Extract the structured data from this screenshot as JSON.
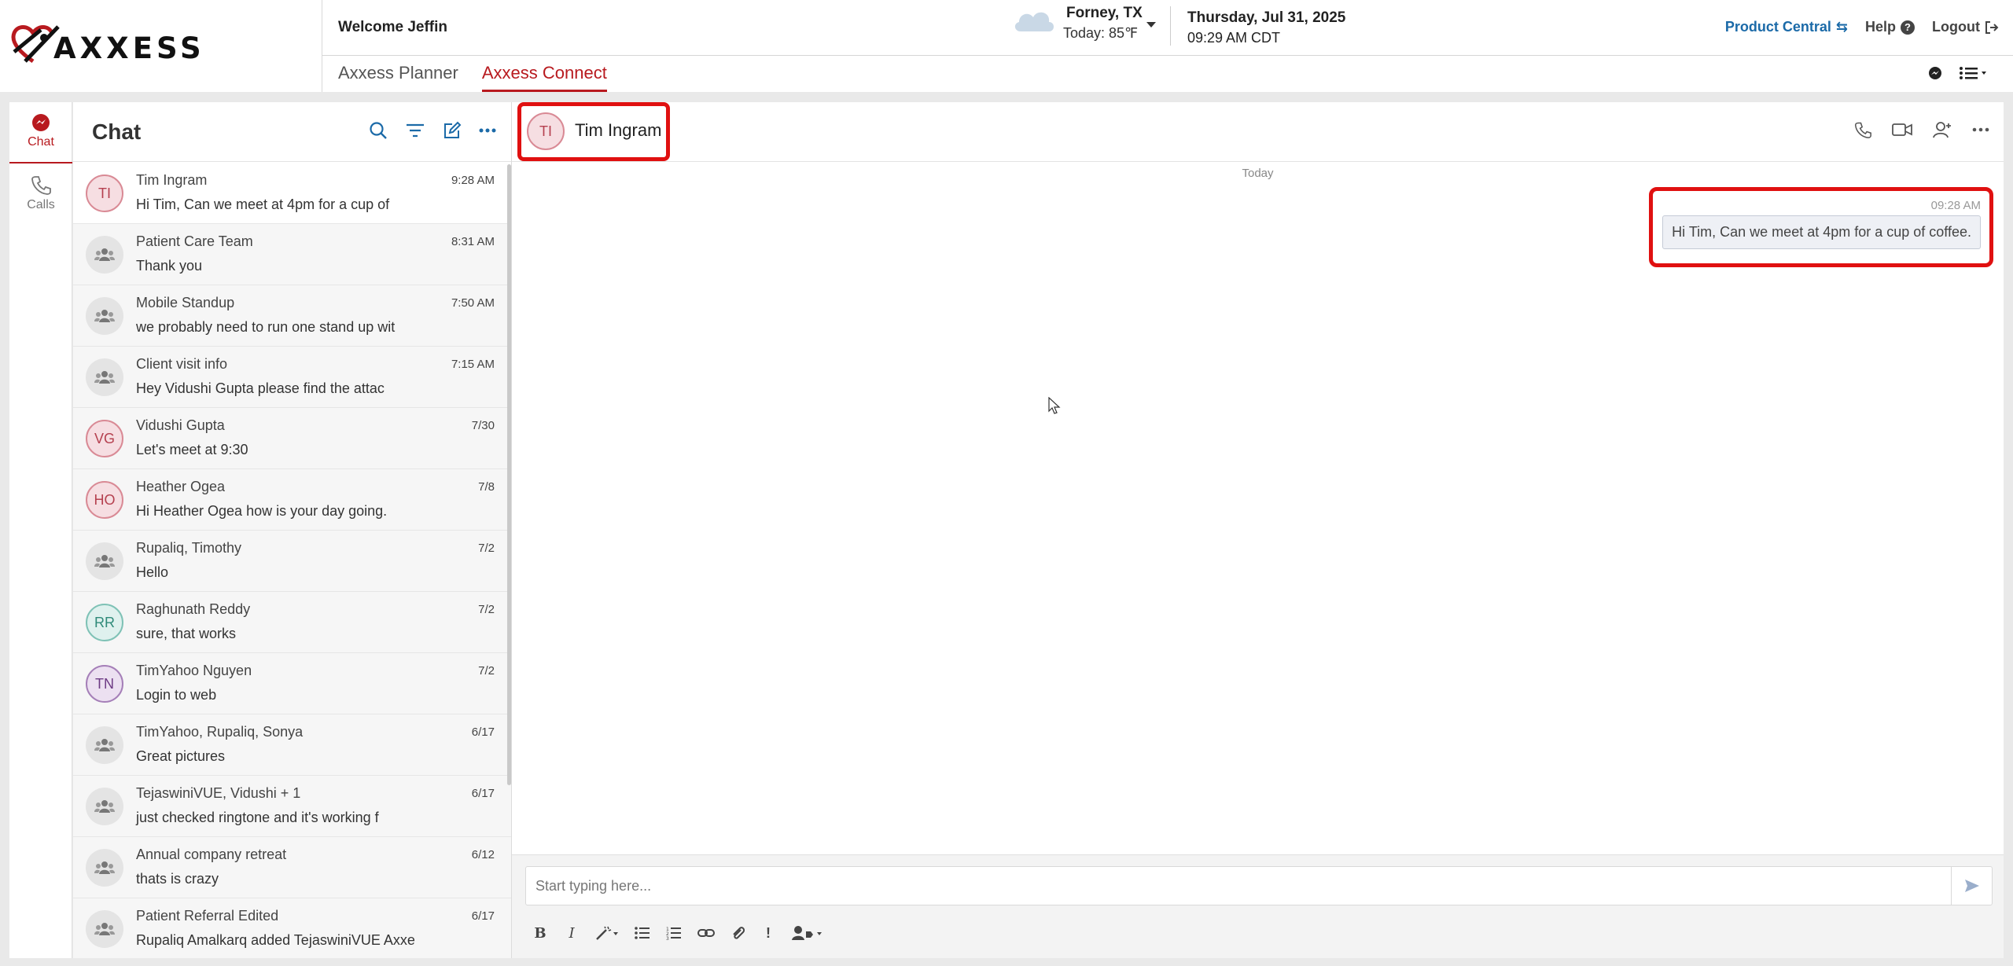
{
  "header": {
    "logo_text": "AXXESS",
    "welcome": "Welcome Jeffin",
    "weather": {
      "city": "Forney, TX",
      "temp": "Today:  85℉",
      "icon": "cloud-icon"
    },
    "date": "Thursday, Jul 31, 2025",
    "time": "09:29 AM CDT",
    "links": {
      "product_central": "Product Central",
      "help": "Help",
      "logout": "Logout"
    },
    "app_tabs": [
      {
        "label": "Axxess Planner",
        "active": false
      },
      {
        "label": "Axxess Connect",
        "active": true
      }
    ]
  },
  "rail": {
    "items": [
      {
        "label": "Chat",
        "icon": "chat-bubble-icon",
        "active": true
      },
      {
        "label": "Calls",
        "icon": "phone-icon",
        "active": false
      }
    ]
  },
  "chat_list": {
    "title": "Chat",
    "items": [
      {
        "initials": "TI",
        "name": "Tim Ingram",
        "message": "Hi Tim, Can we meet at 4pm for a cup of",
        "time": "9:28 AM",
        "avatar_type": "initials",
        "avatar_bg": "#f6dee2",
        "avatar_border": "#d98a95",
        "avatar_fg": "#b5404f"
      },
      {
        "initials": "",
        "name": "Patient Care Team",
        "message": "Thank you",
        "time": "8:31 AM",
        "avatar_type": "group"
      },
      {
        "initials": "",
        "name": "Mobile Standup",
        "message": "we probably need to run one stand up wit",
        "time": "7:50 AM",
        "avatar_type": "group"
      },
      {
        "initials": "",
        "name": "Client visit info",
        "message": "Hey Vidushi Gupta  please find the attac",
        "time": "7:15 AM",
        "avatar_type": "group"
      },
      {
        "initials": "VG",
        "name": "Vidushi Gupta",
        "message": "Let's meet at 9:30",
        "time": "7/30",
        "avatar_type": "initials",
        "avatar_bg": "#f6dee2",
        "avatar_border": "#d98a95",
        "avatar_fg": "#b5404f"
      },
      {
        "initials": "HO",
        "name": "Heather Ogea",
        "message": "Hi Heather Ogea how is your day going.",
        "time": "7/8",
        "avatar_type": "initials",
        "avatar_bg": "#f6dee2",
        "avatar_border": "#d98a95",
        "avatar_fg": "#b5404f"
      },
      {
        "initials": "",
        "name": "Rupaliq, Timothy",
        "message": "Hello",
        "time": "7/2",
        "avatar_type": "group"
      },
      {
        "initials": "RR",
        "name": "Raghunath Reddy",
        "message": "sure, that works",
        "time": "7/2",
        "avatar_type": "initials",
        "avatar_bg": "#dff1ee",
        "avatar_border": "#7fc2b6",
        "avatar_fg": "#2f8a79"
      },
      {
        "initials": "TN",
        "name": "TimYahoo Nguyen",
        "message": "Login to web",
        "time": "7/2",
        "avatar_type": "initials",
        "avatar_bg": "#ece0f1",
        "avatar_border": "#a57fb8",
        "avatar_fg": "#6d3a84"
      },
      {
        "initials": "",
        "name": "TimYahoo, Rupaliq, Sonya",
        "message": "Great pictures",
        "time": "6/17",
        "avatar_type": "group"
      },
      {
        "initials": "",
        "name": "TejaswiniVUE, Vidushi + 1",
        "message": "just checked ringtone and it's working f",
        "time": "6/17",
        "avatar_type": "group"
      },
      {
        "initials": "",
        "name": "Annual company retreat",
        "message": "thats is crazy",
        "time": "6/12",
        "avatar_type": "group"
      },
      {
        "initials": "",
        "name": "Patient Referral Edited",
        "message": "Rupaliq Amalkarq added TejaswiniVUE Axxe",
        "time": "6/17",
        "avatar_type": "group"
      }
    ]
  },
  "conversation": {
    "initials": "TI",
    "name": "Tim Ingram",
    "day_label": "Today",
    "messages": [
      {
        "time": "09:28 AM",
        "text": "Hi Tim, Can we meet at 4pm for a cup of coffee."
      }
    ],
    "composer_placeholder": "Start typing here..."
  },
  "colors": {
    "brand_red": "#b81a1f",
    "link_blue": "#1b6aa8",
    "highlight_red": "#e01010"
  }
}
